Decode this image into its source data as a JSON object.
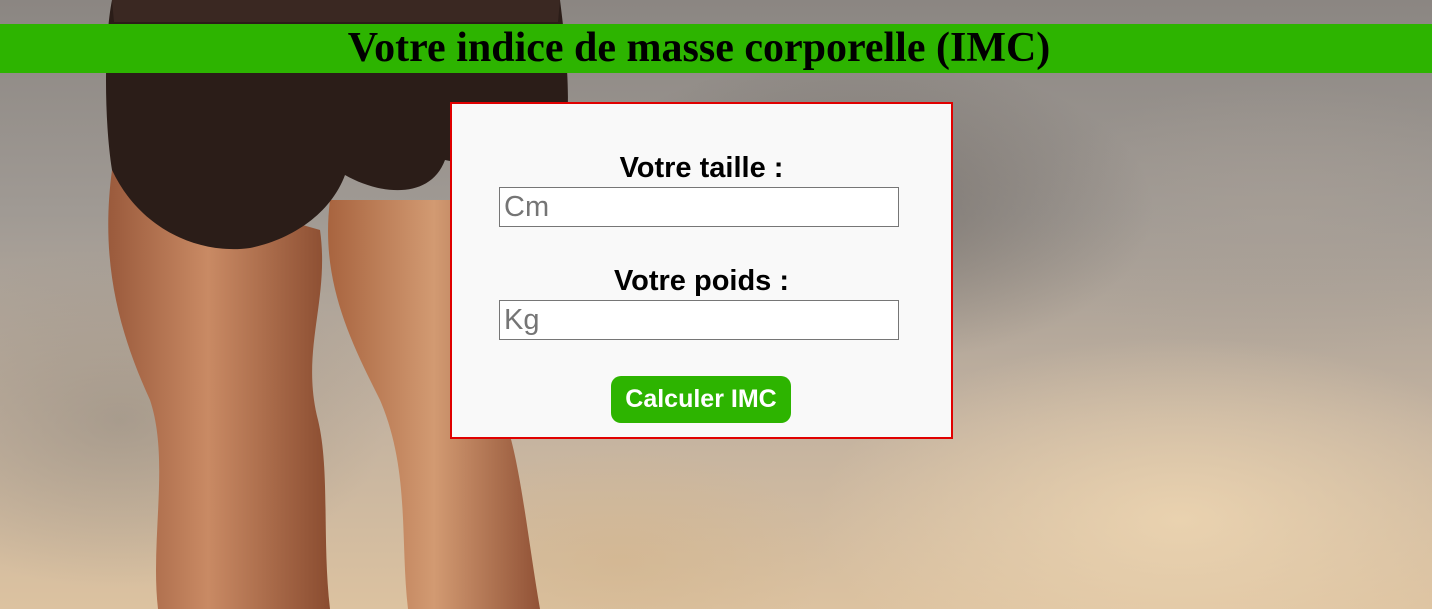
{
  "header": {
    "title": "Votre indice de masse corporelle (IMC)"
  },
  "form": {
    "height_label": "Votre taille :",
    "height_placeholder": "Cm",
    "weight_label": "Votre poids :",
    "weight_placeholder": "Kg",
    "submit_label": "Calculer IMC"
  },
  "colors": {
    "accent": "#2db400",
    "card_border": "#e00000",
    "card_background": "#f9f9f9"
  }
}
